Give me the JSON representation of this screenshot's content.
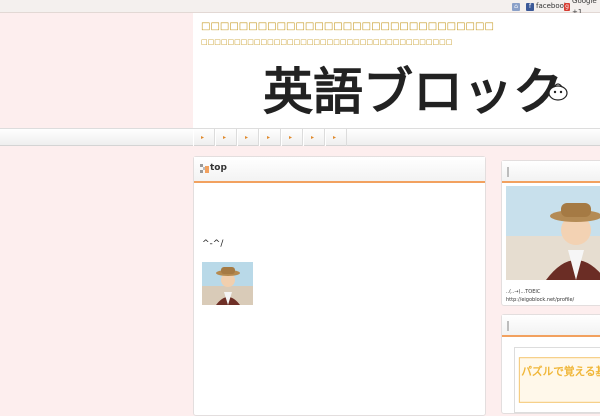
{
  "topbar": {
    "home_icon": "home-icon",
    "facebook_label": "facebook",
    "google_label": "Google +1"
  },
  "header": {
    "site_title": "□□□□□□□□□□□□□□□□□□□□□□□□□□□□□□□",
    "site_description": "□□□□□□□□□□□□□□□□□□□□□□□□□□□□□□□□□□□□□□",
    "logo_text": "英語ブロック"
  },
  "nav": {
    "items": [
      "▸",
      "▸",
      "▸",
      "▸",
      "▸",
      "▸",
      "▸"
    ]
  },
  "post": {
    "title": "top",
    "emoticon": "^-^/"
  },
  "sidebar": {
    "profile_name": "..(..→)...TOEIC",
    "profile_url": "http://eigoblock.net/profile/",
    "book_title": "パズルで覚える基本英単語"
  },
  "colors": {
    "page_bg": "#fdeeee",
    "accent": "#f2a15f",
    "title": "#c69a22"
  }
}
